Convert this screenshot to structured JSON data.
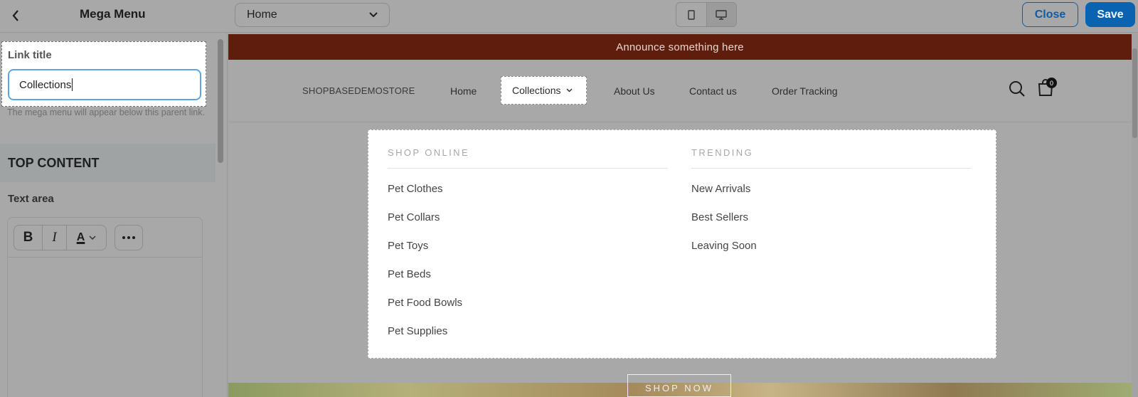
{
  "topbar": {
    "title": "Mega Menu",
    "page_select": "Home",
    "close_label": "Close",
    "save_label": "Save"
  },
  "sidebar": {
    "link_title_label": "Link title",
    "link_title_value": "Collections",
    "help_text": "The mega menu will appear below this parent link.",
    "section_title": "TOP CONTENT",
    "text_area_label": "Text area",
    "toolbar": {
      "bold": "B",
      "italic": "I",
      "color": "A"
    }
  },
  "preview": {
    "announcement": "Announce something here",
    "brand": "SHOPBASEDEMOSTORE",
    "nav": [
      "Home",
      "Collections",
      "About Us",
      "Contact us",
      "Order Tracking"
    ],
    "cart_count": "0",
    "mega_menu": {
      "columns": [
        {
          "heading": "SHOP ONLINE",
          "links": [
            "Pet Clothes",
            "Pet Collars",
            "Pet Toys",
            "Pet Beds",
            "Pet Food Bowls",
            "Pet Supplies"
          ]
        },
        {
          "heading": "TRENDING",
          "links": [
            "New Arrivals",
            "Best Sellers",
            "Leaving Soon"
          ]
        }
      ]
    },
    "hero_button": "SHOP NOW"
  },
  "colors": {
    "accent": "#0a63b0",
    "announcement_bg": "#5f1d0e",
    "input_focus": "#5aa6e4"
  }
}
